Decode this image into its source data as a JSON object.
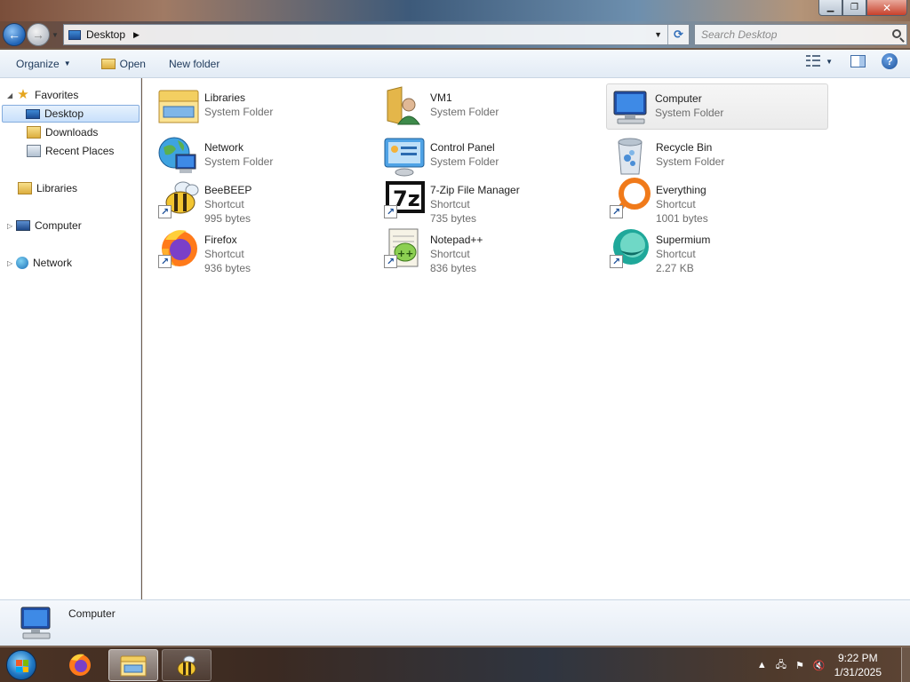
{
  "window": {
    "minimize": "▁",
    "maximize": "❐",
    "close": "✕"
  },
  "address": {
    "path": "Desktop",
    "search_placeholder": "Search Desktop"
  },
  "toolbar": {
    "organize": "Organize",
    "open": "Open",
    "new_folder": "New folder"
  },
  "nav": {
    "favorites": "Favorites",
    "desktop": "Desktop",
    "downloads": "Downloads",
    "recent_places": "Recent Places",
    "libraries": "Libraries",
    "computer": "Computer",
    "network": "Network"
  },
  "items": [
    {
      "name": "Libraries",
      "type": "System Folder",
      "size": "",
      "icon": "libraries-icon"
    },
    {
      "name": "VM1",
      "type": "System Folder",
      "size": "",
      "icon": "user-folder-icon"
    },
    {
      "name": "Computer",
      "type": "System Folder",
      "size": "",
      "icon": "computer-icon",
      "selected": true
    },
    {
      "name": "Network",
      "type": "System Folder",
      "size": "",
      "icon": "network-icon"
    },
    {
      "name": "Control Panel",
      "type": "System Folder",
      "size": "",
      "icon": "control-panel-icon"
    },
    {
      "name": "Recycle Bin",
      "type": "System Folder",
      "size": "",
      "icon": "recycle-bin-icon"
    },
    {
      "name": "BeeBEEP",
      "type": "Shortcut",
      "size": "995 bytes",
      "icon": "beebeep-icon"
    },
    {
      "name": "7-Zip File Manager",
      "type": "Shortcut",
      "size": "735 bytes",
      "icon": "7zip-icon"
    },
    {
      "name": "Everything",
      "type": "Shortcut",
      "size": "1001 bytes",
      "icon": "everything-icon"
    },
    {
      "name": "Firefox",
      "type": "Shortcut",
      "size": "936 bytes",
      "icon": "firefox-icon"
    },
    {
      "name": "Notepad++",
      "type": "Shortcut",
      "size": "836 bytes",
      "icon": "notepadpp-icon"
    },
    {
      "name": "Supermium",
      "type": "Shortcut",
      "size": "2.27 KB",
      "icon": "supermium-icon"
    }
  ],
  "details": {
    "name": "Computer"
  },
  "taskbar": {
    "time": "9:22 PM",
    "date": "1/31/2025"
  },
  "colors": {
    "selection": "#cce4fb",
    "toolbar_text": "#1e395b"
  }
}
